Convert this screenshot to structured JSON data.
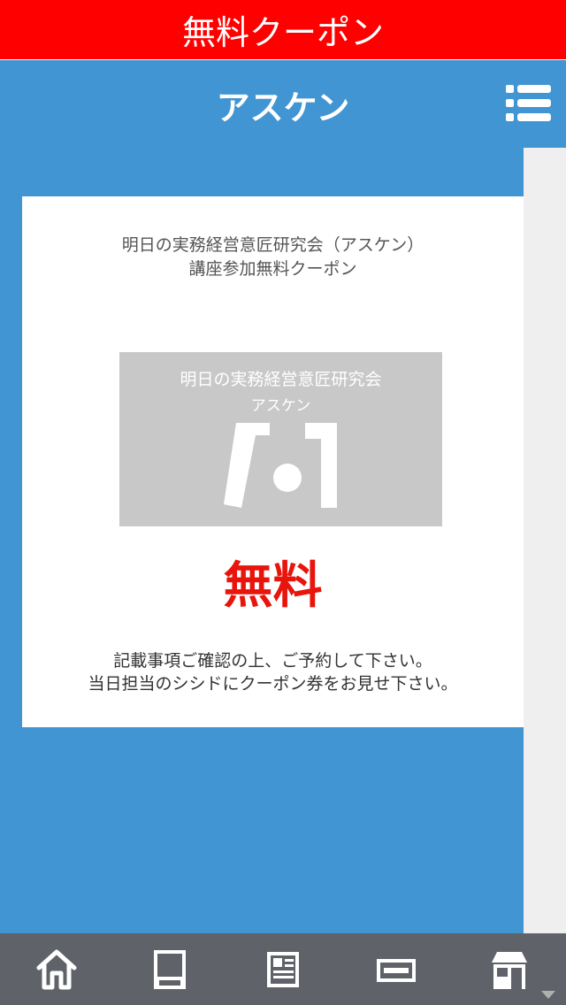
{
  "banner": {
    "title": "無料クーポン"
  },
  "header": {
    "title": "アスケン",
    "menu_icon": "list-menu-icon"
  },
  "coupon": {
    "heading_line1": "明日の実務経営意匠研究会（アスケン）",
    "heading_line2": "講座参加無料クーポン",
    "logo_line1": "明日の実務経営意匠研究会",
    "logo_line2": "アスケン",
    "badge": "無料",
    "note_line1": "記載事項ご確認の上、ご予約して下さい。",
    "note_line2": "当日担当のシシドにクーポン券をお見せ下さい。"
  },
  "footer": {
    "tabs": [
      {
        "icon": "home-icon"
      },
      {
        "icon": "menu-book-icon"
      },
      {
        "icon": "news-icon"
      },
      {
        "icon": "coupon-icon"
      },
      {
        "icon": "shop-icon"
      }
    ]
  },
  "colors": {
    "banner": "#ff0000",
    "primary": "#4195d2",
    "footer": "#5f6369",
    "accent_red": "#e8150c"
  }
}
